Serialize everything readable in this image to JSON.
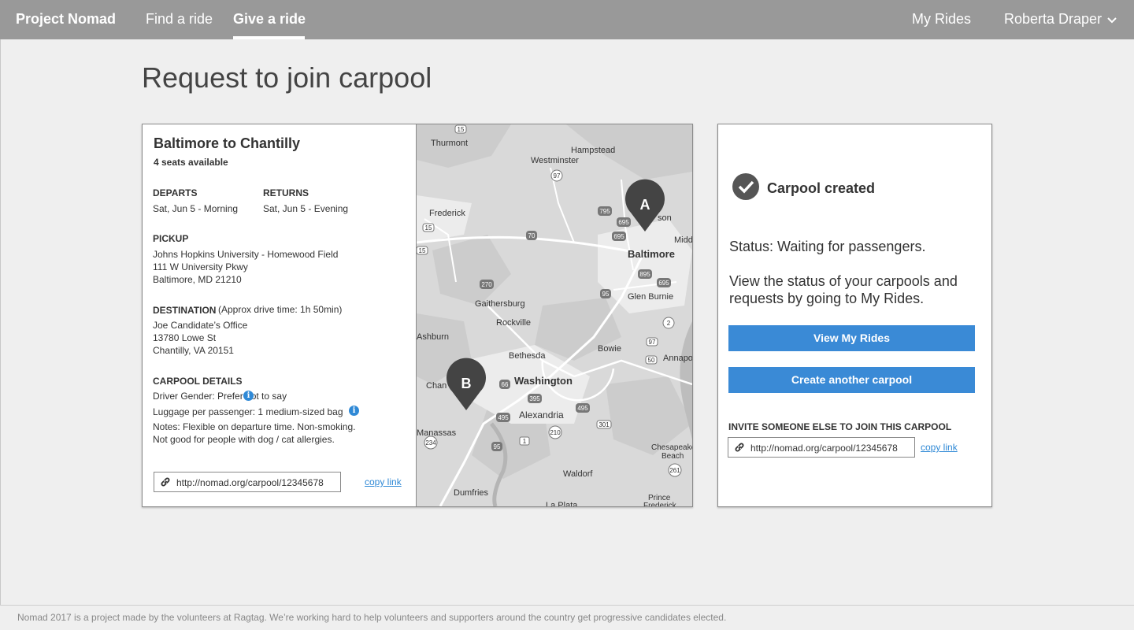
{
  "nav": {
    "brand": "Project Nomad",
    "find_ride": "Find a ride",
    "give_ride": "Give a ride",
    "my_rides": "My Rides",
    "user": "Roberta Draper"
  },
  "page": {
    "title": "Request to join carpool"
  },
  "carpool": {
    "title": "Baltimore to Chantilly",
    "seats": "4 seats available",
    "departs_label": "DEPARTS",
    "departs": "Sat, Jun 5 - Morning",
    "returns_label": "RETURNS",
    "returns": "Sat, Jun 5 - Evening",
    "pickup_label": "PICKUP",
    "pickup_lines": [
      "Johns Hopkins University - Homewood Field",
      "111 W University Pkwy",
      "Baltimore, MD 21210"
    ],
    "destination_label": "DESTINATION",
    "destination_note": "(Approx drive time: 1h 50min)",
    "destination_lines": [
      "Joe Candidate’s Office",
      "13780 Lowe St",
      "Chantilly, VA 20151"
    ],
    "details_label": "CARPOOL DETAILS",
    "driver_gender": "Driver Gender: Prefer not to say",
    "luggage": "Luggage per passenger: 1 medium-sized bag",
    "notes_lines": [
      "Notes: Flexible on departure time. Non-smoking.",
      "Not good for people with dog / cat allergies."
    ],
    "link": "http://nomad.org/carpool/12345678",
    "copy_link": "copy link"
  },
  "map": {
    "marker_a": "A",
    "marker_b": "B",
    "places": [
      "Thurmont",
      "Hampstead",
      "Westminster",
      "Frederick",
      "Baltimore",
      "Middl",
      "Gaithersburg",
      "Glen Burnie",
      "Rockville",
      "Bowie",
      "Ashburn",
      "Annapo",
      "Bethesda",
      "Washington",
      "Chan",
      "Alexandria",
      "Manassas",
      "Chesapeake Beach",
      "Waldorf",
      "Dumfries",
      "La Plata",
      "Prince Frederick",
      "son"
    ],
    "route_shields": [
      "15",
      "97",
      "795",
      "695",
      "695",
      "70",
      "15",
      "270",
      "895",
      "695",
      "95",
      "2",
      "97",
      "50",
      "495",
      "395",
      "66",
      "210",
      "301",
      "495",
      "1",
      "95",
      "234",
      "261",
      "15"
    ]
  },
  "status": {
    "created": "Carpool created",
    "status_text": "Status: Waiting for passengers.",
    "description": "View the status of your carpools and requests by going to My Rides.",
    "view_button": "View My Rides",
    "create_button": "Create another carpool",
    "invite_label": "INVITE SOMEONE ELSE TO JOIN THIS CARPOOL",
    "link": "http://nomad.org/carpool/12345678",
    "copy_link": "copy link"
  },
  "footer": {
    "text": "Nomad 2017 is a project made by the volunteers at Ragtag. We’re working hard to help volunteers and supporters around the country get progressive candidates elected."
  },
  "colors": {
    "nav_bg": "#999999",
    "accent": "#3a8ad6",
    "page_bg": "#efefef"
  }
}
